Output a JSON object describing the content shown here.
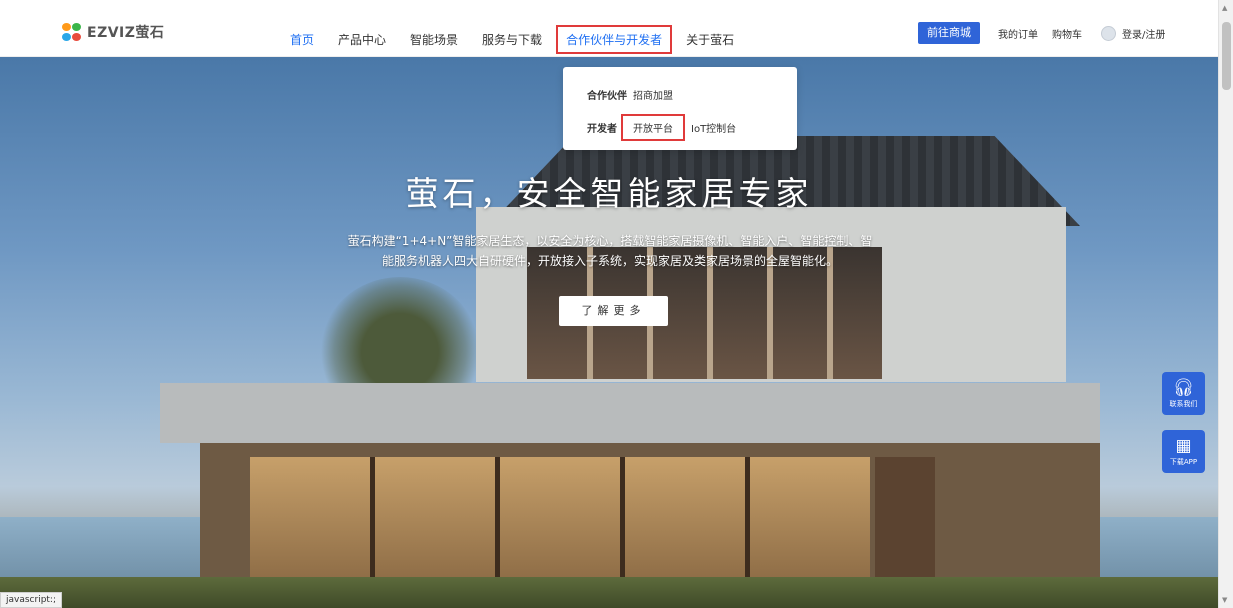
{
  "brand": {
    "logo_text": "EZVIZ萤石"
  },
  "nav": {
    "items": [
      {
        "label": "首页"
      },
      {
        "label": "产品中心"
      },
      {
        "label": "智能场景"
      },
      {
        "label": "服务与下载"
      },
      {
        "label": "合作伙伴与开发者"
      },
      {
        "label": "关于萤石"
      }
    ]
  },
  "topbar": {
    "shop_label": "前往商城",
    "orders_label": "我的订单",
    "cart_label": "购物车",
    "login_label": "登录/注册"
  },
  "dropdown": {
    "partner": {
      "category": "合作伙伴",
      "links": [
        "招商加盟"
      ]
    },
    "developer": {
      "category": "开发者",
      "links": [
        "开放平台",
        "IoT控制台"
      ]
    }
  },
  "hero": {
    "title": "萤石，安全智能家居专家",
    "desc_line1": "萤石构建“1+4+N”智能家居生态，以安全为核心，搭载智能家居摄像机、智能入户、智能控制、智",
    "desc_line2": "能服务机器人四大自研硬件，开放接入子系统，实现家居及类家居场景的全屋智能化。",
    "button_label": "了解更多"
  },
  "float": {
    "contact_label": "联系我们",
    "download_label": "下载APP"
  },
  "status_bar": {
    "text": "javascript:;"
  },
  "colors": {
    "accent": "#2f64d8",
    "highlight_box": "#e03a3a",
    "active_nav": "#1f6ff2"
  }
}
